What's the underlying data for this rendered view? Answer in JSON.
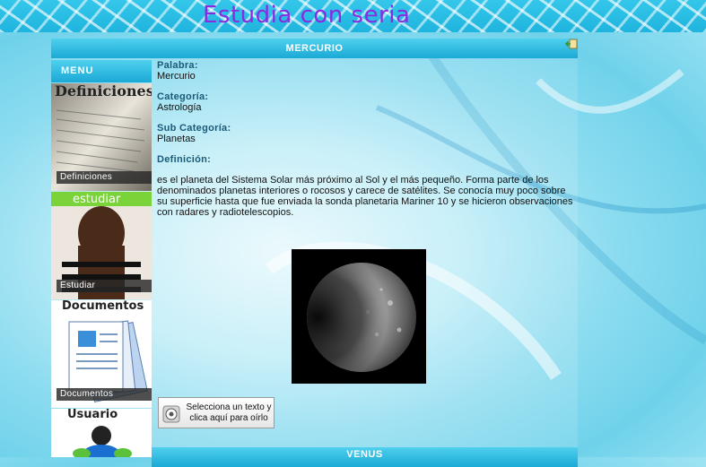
{
  "site": {
    "title": "Estudia con seria"
  },
  "entry": {
    "title": "MERCURIO",
    "word_label": "Palabra:",
    "word": "Mercurio",
    "category_label": "Categoría:",
    "category": "Astrología",
    "subcategory_label": "Sub Categoría:",
    "subcategory": "Planetas",
    "definition_label": "Definición:",
    "definition": "es el planeta del Sistema Solar más próximo al Sol y el más pequeño. Forma parte de los denominados planetas interiores o rocosos y carece de satélites. Se conocía muy poco sobre su superficie hasta que fue enviada la sonda planetaria Mariner 10 y se hicieron observaciones con radares y radiotelescopios."
  },
  "menu": {
    "header": "MENU",
    "items": [
      {
        "label": "Definiciones",
        "image_text": "Definiciones",
        "icon": "newspaper-image"
      },
      {
        "label": "Estudiar",
        "image_text": "estudiar",
        "icon": "student-image"
      },
      {
        "label": "Documentos",
        "image_text": "Documentos",
        "icon": "documents-image"
      },
      {
        "label": "",
        "image_text": "Usuario",
        "icon": "user-image"
      }
    ]
  },
  "speak_button": {
    "text": "Selecciona un texto y clica aquí para oírlo",
    "icon": "speaker-icon"
  },
  "next_entry": {
    "title": "VENUS"
  },
  "colors": {
    "accent": "#1fb4de",
    "title_purple": "#8a2be2",
    "label_blue": "#1a5a78"
  }
}
